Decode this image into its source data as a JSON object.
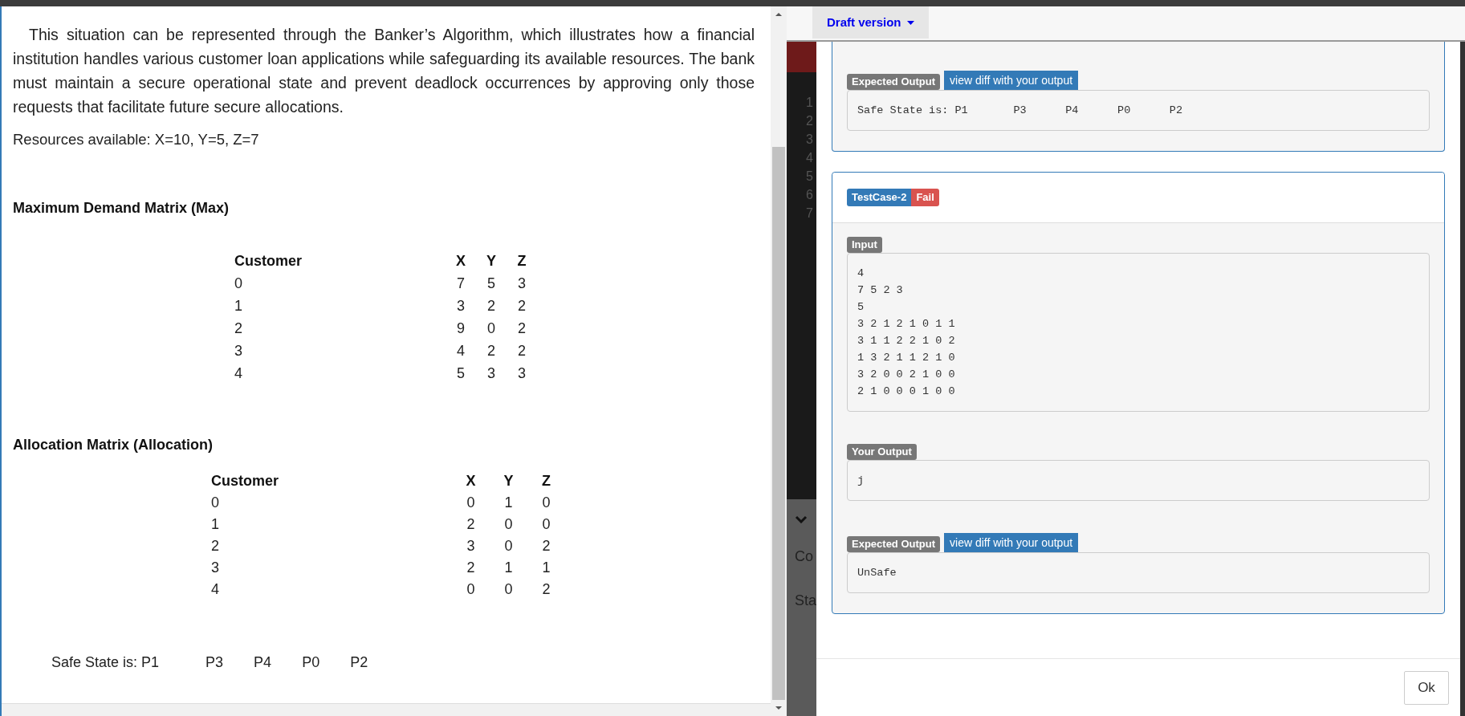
{
  "problem": {
    "paragraph": "This situation can be represented through the Banker’s Algorithm, which illustrates how a financial institution handles various customer loan applications while safeguarding its available resources. The bank must maintain a secure operational state and prevent deadlock occurrences by approving only those requests that facilitate future secure allocations.",
    "resources": "Resources available: X=10, Y=5, Z=7",
    "matrices": [
      {
        "title": "Maximum Demand Matrix (Max)",
        "columns": [
          "Customer",
          "X",
          "Y",
          "Z"
        ],
        "rows": [
          [
            "0",
            "7",
            "5",
            "3"
          ],
          [
            "1",
            "3",
            "2",
            "2"
          ],
          [
            "2",
            "9",
            "0",
            "2"
          ],
          [
            "3",
            "4",
            "2",
            "2"
          ],
          [
            "4",
            "5",
            "3",
            "3"
          ]
        ]
      },
      {
        "title": "Allocation Matrix (Allocation)",
        "columns": [
          "Customer",
          "X",
          "Y",
          "Z"
        ],
        "rows": [
          [
            "0",
            "0",
            "1",
            "0"
          ],
          [
            "1",
            "2",
            "0",
            "0"
          ],
          [
            "2",
            "3",
            "0",
            "2"
          ],
          [
            "3",
            "2",
            "1",
            "1"
          ],
          [
            "4",
            "0",
            "0",
            "2"
          ]
        ]
      }
    ],
    "safe_state": [
      "Safe State is: P1",
      "P3",
      "P4",
      "P0",
      "P2"
    ]
  },
  "toolbar": {
    "version_menu": "Draft version"
  },
  "editor": {
    "line_numbers": [
      "1",
      "2",
      "3",
      "4",
      "5",
      "6",
      "7"
    ],
    "panel_labels": [
      "Co",
      "Sta"
    ]
  },
  "modal": {
    "cards": [
      {
        "kind": "partial",
        "sections": [
          {
            "label": "Expected Output",
            "diff_link": "view diff with your output",
            "lines": [
              "Safe State is: P1       P3      P4      P0      P2"
            ]
          }
        ]
      },
      {
        "kind": "full",
        "name": "TestCase-2",
        "result": "Fail",
        "passed": false,
        "sections": [
          {
            "label": "Input",
            "lines": [
              "4",
              "7 5 2 3",
              "5",
              "3 2 1 2 1 0 1 1",
              "3 1 1 2 2 1 0 2",
              "1 3 2 1 1 2 1 0",
              "3 2 0 0 2 1 0 0",
              "2 1 0 0 0 1 0 0"
            ]
          },
          {
            "label": "Your Output",
            "lines": [
              "j"
            ]
          },
          {
            "label": "Expected Output",
            "diff_link": "view diff with your output",
            "lines": [
              "UnSafe"
            ]
          }
        ]
      }
    ],
    "ok_button": "Ok"
  }
}
